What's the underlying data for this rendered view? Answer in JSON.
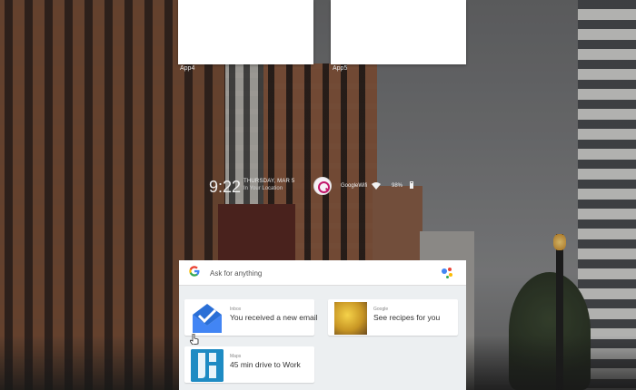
{
  "apps": [
    {
      "label": "App4"
    },
    {
      "label": "App5"
    }
  ],
  "status": {
    "time": "9:22",
    "date": "THURSDAY, MAR 5",
    "location": "In Your Location",
    "carrier": "GoogleWifi",
    "battery": "98%"
  },
  "search": {
    "placeholder": "Ask for anything",
    "logo": "G"
  },
  "cards": [
    {
      "source": "Inbox",
      "text": "You received a new email",
      "icon": "inbox-icon"
    },
    {
      "source": "Google",
      "text": "See recipes for you",
      "icon": "recipe-photo"
    },
    {
      "source": "Maps",
      "text": "45 min drive to Work",
      "icon": "maps-icon"
    }
  ],
  "colors": {
    "google_blue": "#4285f4",
    "assistant_pink": "#c2186b",
    "panel_bg": "#eceff1",
    "inbox_blue": "#4285f4",
    "maps_blue": "#1e8bc3"
  }
}
